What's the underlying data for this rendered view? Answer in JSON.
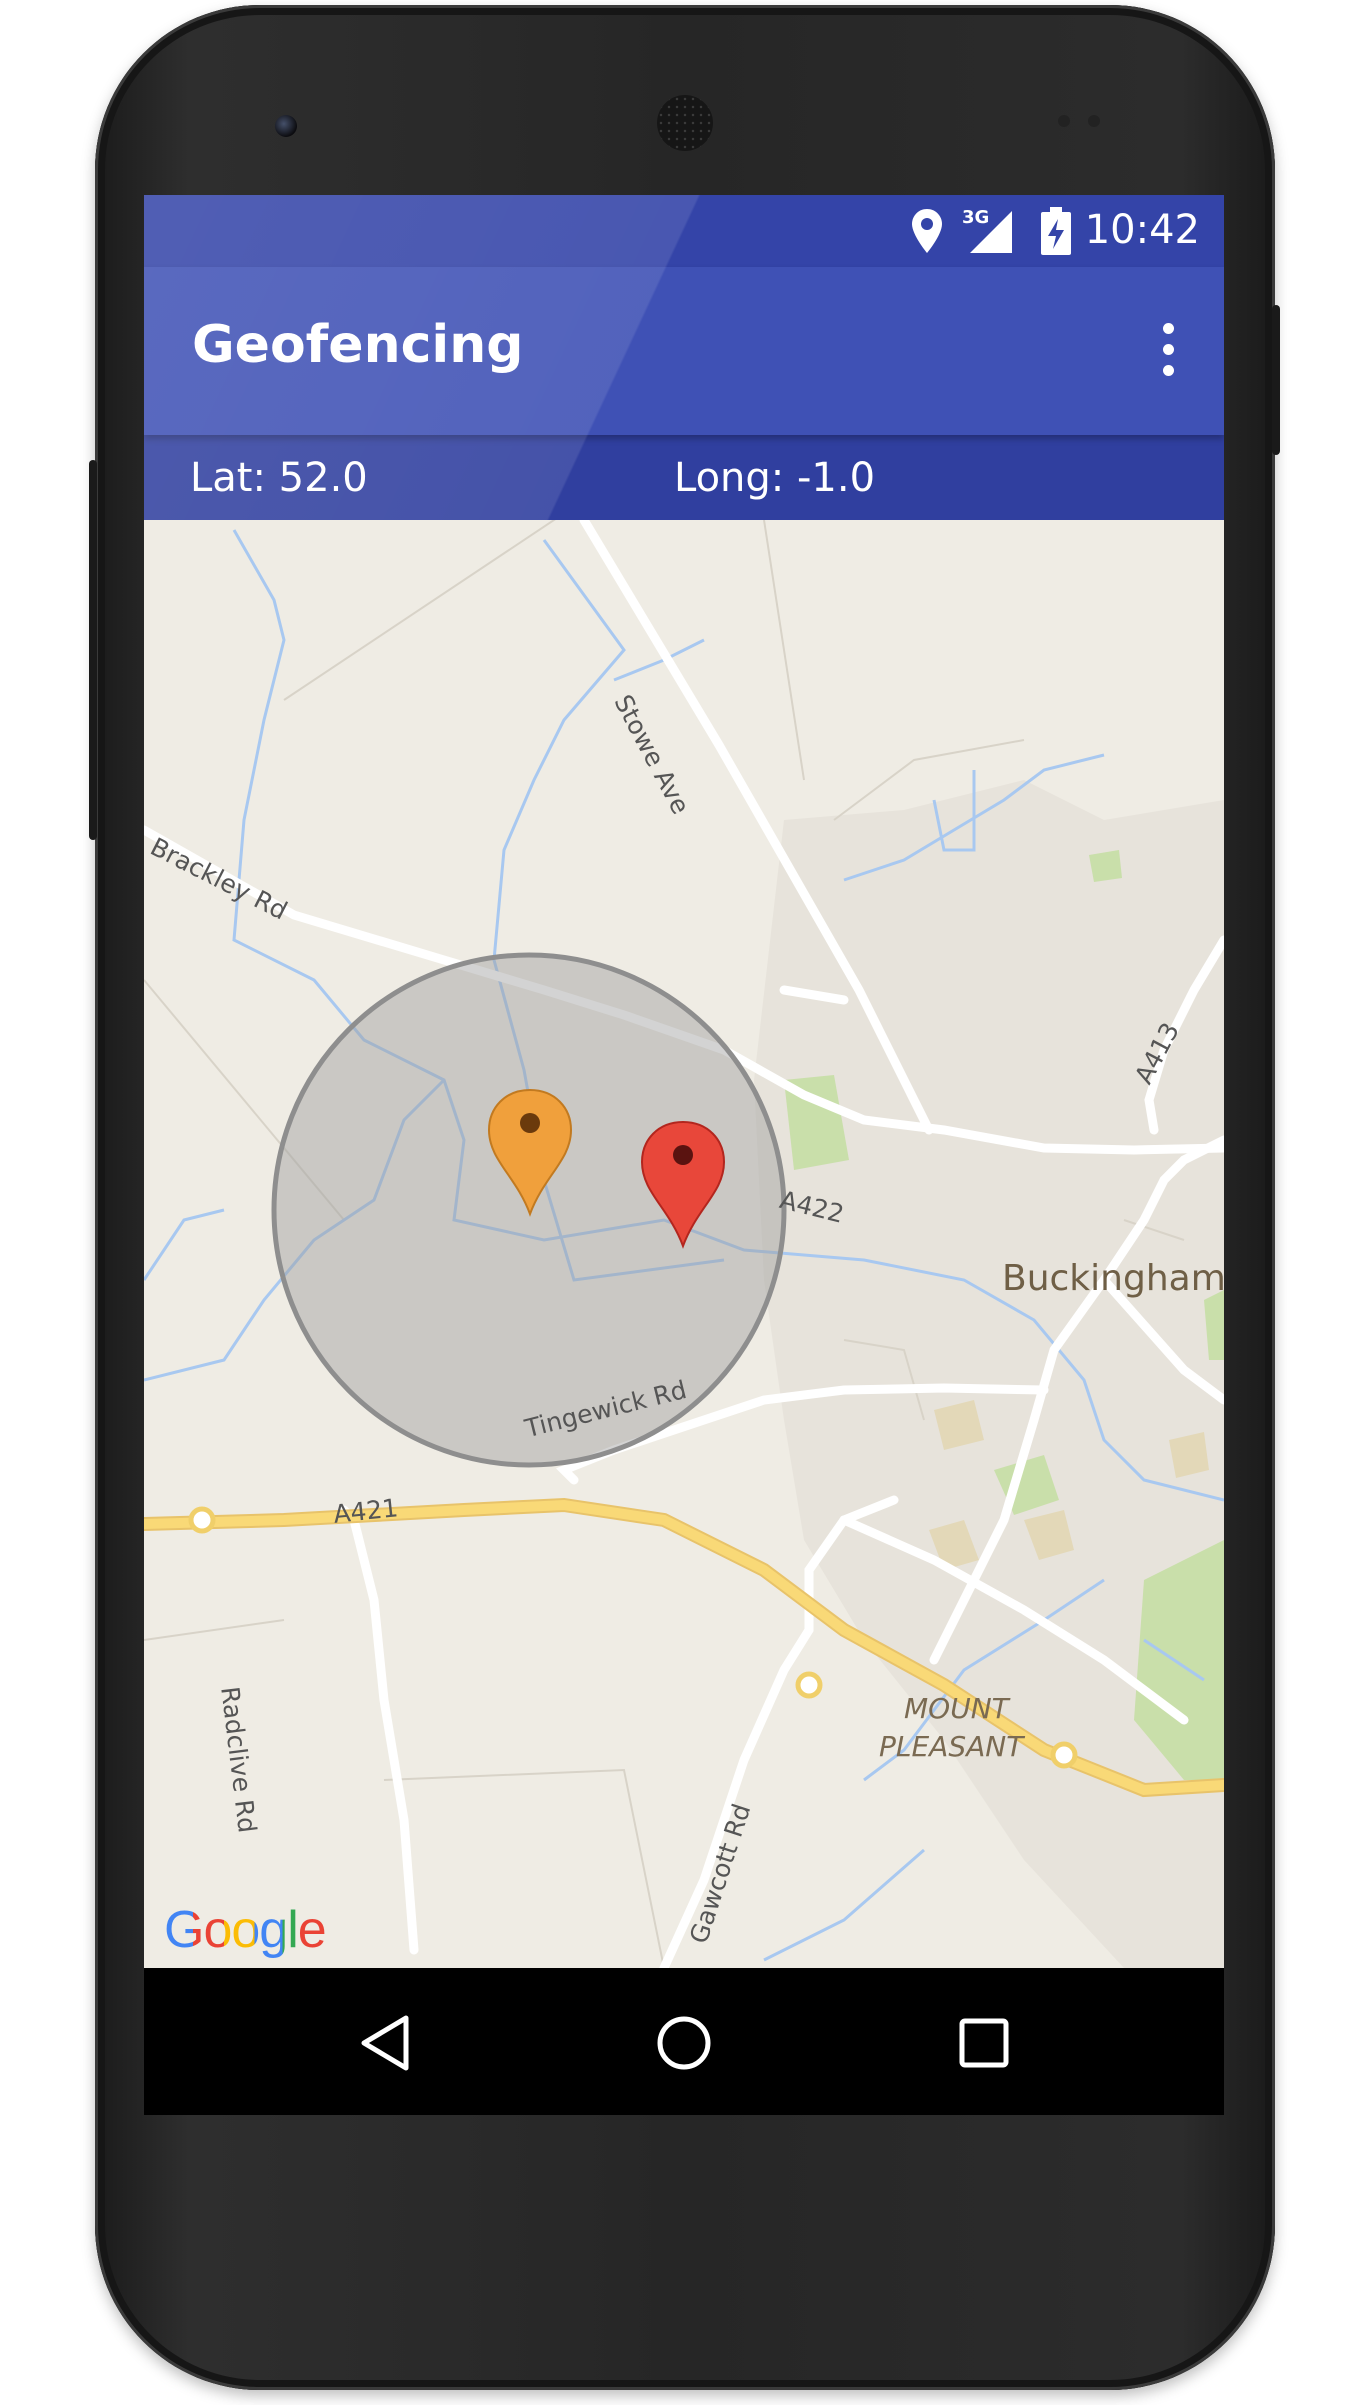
{
  "status_bar": {
    "time": "10:42",
    "network_label": "3G",
    "icons": [
      "location-icon",
      "signal-icon",
      "battery-charging-icon"
    ]
  },
  "app_bar": {
    "title": "Geofencing",
    "menu_icon": "overflow-menu-icon"
  },
  "coordinates": {
    "lat": "Lat: 52.0",
    "long": "Long: -1.0"
  },
  "map": {
    "attribution": "Google",
    "labels": {
      "stowe_ave": "Stowe Ave",
      "brackley_rd": "Brackley Rd",
      "a413": "A413",
      "a422": "A422",
      "buckingham": "Buckingham",
      "tingewick_rd": "Tingewick Rd",
      "a421": "A421",
      "mount": "MOUNT",
      "pleasant": "PLEASANT",
      "radclive_rd": "Radclive Rd",
      "gawcott_rd": "Gawcott Rd"
    },
    "markers": [
      {
        "name": "geofence-center-marker",
        "color": "#f0a03c"
      },
      {
        "name": "current-location-marker",
        "color": "#e8473a"
      }
    ],
    "geofence_color": "#9e9e9e"
  },
  "nav_bar": {
    "buttons": [
      "back-icon",
      "home-icon",
      "recents-icon"
    ]
  },
  "colors": {
    "primary": "#3f51b5",
    "primary_dark": "#303f9f",
    "map_background": "#efece4",
    "water": "#a8c8f0",
    "major_road": "#f9d977"
  }
}
